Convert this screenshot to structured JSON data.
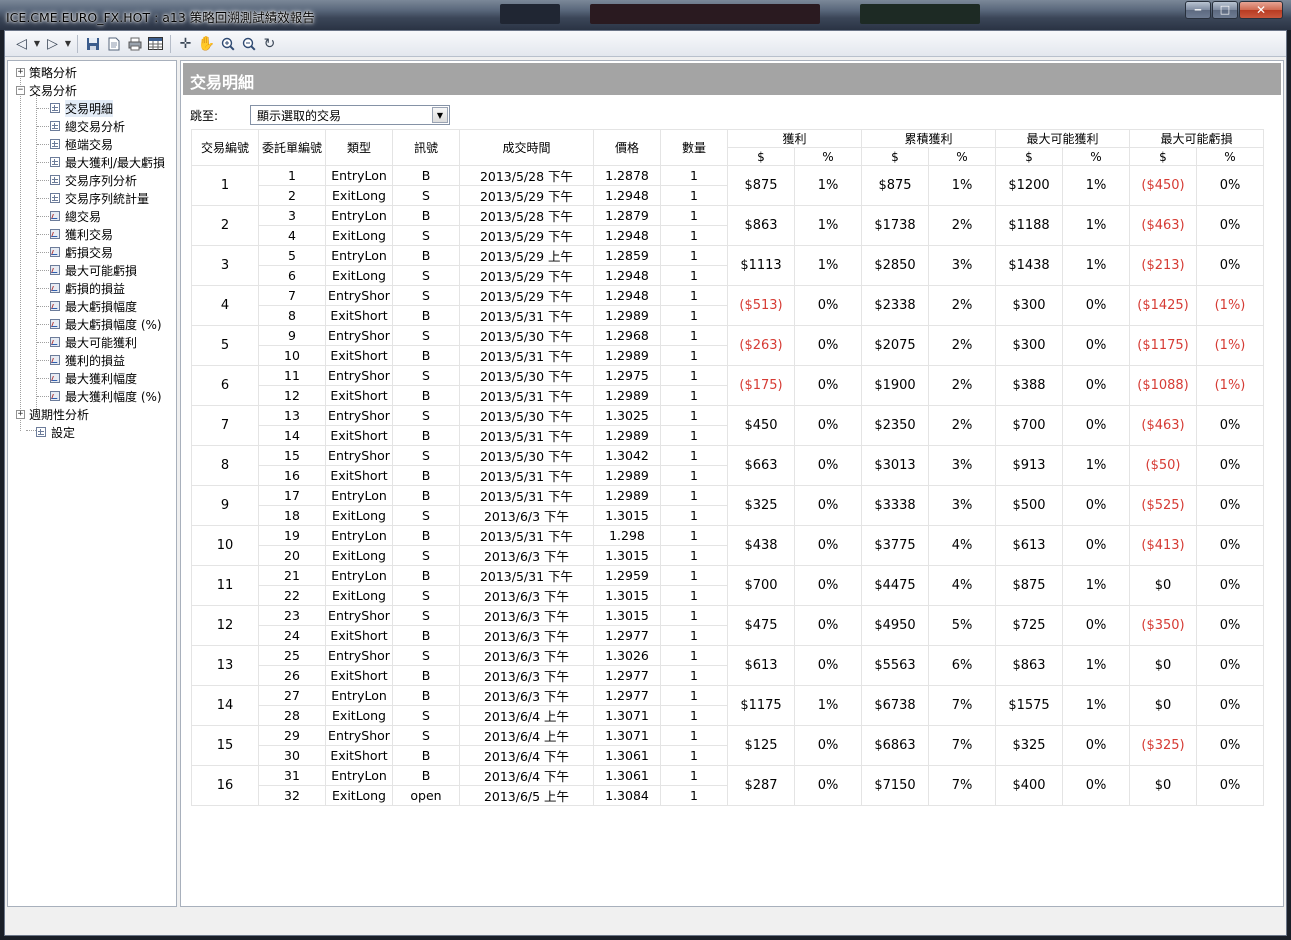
{
  "window": {
    "title": "ICE.CME.EURO_FX.HOT : a13 策略回溯測試績效報告",
    "minimize": "‒",
    "maximize": "□",
    "close": "✕"
  },
  "toolbar": {
    "icons": [
      "back-icon",
      "dropdown-arrow-icon",
      "forward-icon",
      "dropdown-arrow-icon",
      "save-icon",
      "page-icon",
      "print-icon",
      "table-icon",
      "crosshair-icon",
      "hand-icon",
      "zoom-in-icon",
      "zoom-out-icon",
      "rotate-icon"
    ]
  },
  "tree": {
    "strategy": "策略分析",
    "trade": "交易分析",
    "children": [
      "交易明細",
      "總交易分析",
      "極端交易",
      "最大獲利/最大虧損",
      "交易序列分析",
      "交易序列統計量",
      "總交易",
      "獲利交易",
      "虧損交易",
      "最大可能虧損",
      "虧損的損益",
      "最大虧損幅度",
      "最大虧損幅度 (%)",
      "最大可能獲利",
      "獲利的損益",
      "最大獲利幅度",
      "最大獲利幅度 (%)"
    ],
    "periodic": "週期性分析",
    "settings": "設定",
    "selected": "交易明細",
    "expand": "+",
    "collapse": "−"
  },
  "panel": {
    "title": "交易明細",
    "jump_label": "跳至:",
    "jump_value": "顯示選取的交易",
    "dropdown_arrow": "▼"
  },
  "table": {
    "headers": {
      "trade_no": "交易編號",
      "order_no": "委託單編號",
      "type": "類型",
      "signal": "訊號",
      "time": "成交時間",
      "price": "價格",
      "qty": "數量",
      "profit": "獲利",
      "cum_profit": "累積獲利",
      "max_profit": "最大可能獲利",
      "max_loss": "最大可能虧損",
      "dollar": "$",
      "pct": "%"
    },
    "trades": [
      {
        "no": "1",
        "legs": [
          {
            "order": "1",
            "type": "EntryLon",
            "signal": "B",
            "time": "2013/5/28 下午",
            "price": "1.2878",
            "qty": "1"
          },
          {
            "order": "2",
            "type": "ExitLong",
            "signal": "S",
            "time": "2013/5/29 下午",
            "price": "1.2948",
            "qty": "1"
          }
        ],
        "profit": "$875",
        "profit_pct": "1%",
        "cum": "$875",
        "cum_pct": "1%",
        "mfe": "$1200",
        "mfe_pct": "1%",
        "mae": "($450)",
        "mae_pct": "0%"
      },
      {
        "no": "2",
        "legs": [
          {
            "order": "3",
            "type": "EntryLon",
            "signal": "B",
            "time": "2013/5/28 下午",
            "price": "1.2879",
            "qty": "1"
          },
          {
            "order": "4",
            "type": "ExitLong",
            "signal": "S",
            "time": "2013/5/29 下午",
            "price": "1.2948",
            "qty": "1"
          }
        ],
        "profit": "$863",
        "profit_pct": "1%",
        "cum": "$1738",
        "cum_pct": "2%",
        "mfe": "$1188",
        "mfe_pct": "1%",
        "mae": "($463)",
        "mae_pct": "0%"
      },
      {
        "no": "3",
        "legs": [
          {
            "order": "5",
            "type": "EntryLon",
            "signal": "B",
            "time": "2013/5/29 上午",
            "price": "1.2859",
            "qty": "1"
          },
          {
            "order": "6",
            "type": "ExitLong",
            "signal": "S",
            "time": "2013/5/29 下午",
            "price": "1.2948",
            "qty": "1"
          }
        ],
        "profit": "$1113",
        "profit_pct": "1%",
        "cum": "$2850",
        "cum_pct": "3%",
        "mfe": "$1438",
        "mfe_pct": "1%",
        "mae": "($213)",
        "mae_pct": "0%"
      },
      {
        "no": "4",
        "legs": [
          {
            "order": "7",
            "type": "EntryShor",
            "signal": "S",
            "time": "2013/5/29 下午",
            "price": "1.2948",
            "qty": "1"
          },
          {
            "order": "8",
            "type": "ExitShort",
            "signal": "B",
            "time": "2013/5/31 下午",
            "price": "1.2989",
            "qty": "1"
          }
        ],
        "profit": "($513)",
        "profit_pct": "0%",
        "cum": "$2338",
        "cum_pct": "2%",
        "mfe": "$300",
        "mfe_pct": "0%",
        "mae": "($1425)",
        "mae_pct": "(1%)"
      },
      {
        "no": "5",
        "legs": [
          {
            "order": "9",
            "type": "EntryShor",
            "signal": "S",
            "time": "2013/5/30 下午",
            "price": "1.2968",
            "qty": "1"
          },
          {
            "order": "10",
            "type": "ExitShort",
            "signal": "B",
            "time": "2013/5/31 下午",
            "price": "1.2989",
            "qty": "1"
          }
        ],
        "profit": "($263)",
        "profit_pct": "0%",
        "cum": "$2075",
        "cum_pct": "2%",
        "mfe": "$300",
        "mfe_pct": "0%",
        "mae": "($1175)",
        "mae_pct": "(1%)"
      },
      {
        "no": "6",
        "legs": [
          {
            "order": "11",
            "type": "EntryShor",
            "signal": "S",
            "time": "2013/5/30 下午",
            "price": "1.2975",
            "qty": "1"
          },
          {
            "order": "12",
            "type": "ExitShort",
            "signal": "B",
            "time": "2013/5/31 下午",
            "price": "1.2989",
            "qty": "1"
          }
        ],
        "profit": "($175)",
        "profit_pct": "0%",
        "cum": "$1900",
        "cum_pct": "2%",
        "mfe": "$388",
        "mfe_pct": "0%",
        "mae": "($1088)",
        "mae_pct": "(1%)"
      },
      {
        "no": "7",
        "legs": [
          {
            "order": "13",
            "type": "EntryShor",
            "signal": "S",
            "time": "2013/5/30 下午",
            "price": "1.3025",
            "qty": "1"
          },
          {
            "order": "14",
            "type": "ExitShort",
            "signal": "B",
            "time": "2013/5/31 下午",
            "price": "1.2989",
            "qty": "1"
          }
        ],
        "profit": "$450",
        "profit_pct": "0%",
        "cum": "$2350",
        "cum_pct": "2%",
        "mfe": "$700",
        "mfe_pct": "0%",
        "mae": "($463)",
        "mae_pct": "0%"
      },
      {
        "no": "8",
        "legs": [
          {
            "order": "15",
            "type": "EntryShor",
            "signal": "S",
            "time": "2013/5/30 下午",
            "price": "1.3042",
            "qty": "1"
          },
          {
            "order": "16",
            "type": "ExitShort",
            "signal": "B",
            "time": "2013/5/31 下午",
            "price": "1.2989",
            "qty": "1"
          }
        ],
        "profit": "$663",
        "profit_pct": "0%",
        "cum": "$3013",
        "cum_pct": "3%",
        "mfe": "$913",
        "mfe_pct": "1%",
        "mae": "($50)",
        "mae_pct": "0%"
      },
      {
        "no": "9",
        "legs": [
          {
            "order": "17",
            "type": "EntryLon",
            "signal": "B",
            "time": "2013/5/31 下午",
            "price": "1.2989",
            "qty": "1"
          },
          {
            "order": "18",
            "type": "ExitLong",
            "signal": "S",
            "time": "2013/6/3 下午",
            "price": "1.3015",
            "qty": "1"
          }
        ],
        "profit": "$325",
        "profit_pct": "0%",
        "cum": "$3338",
        "cum_pct": "3%",
        "mfe": "$500",
        "mfe_pct": "0%",
        "mae": "($525)",
        "mae_pct": "0%"
      },
      {
        "no": "10",
        "legs": [
          {
            "order": "19",
            "type": "EntryLon",
            "signal": "B",
            "time": "2013/5/31 下午",
            "price": "1.298",
            "qty": "1"
          },
          {
            "order": "20",
            "type": "ExitLong",
            "signal": "S",
            "time": "2013/6/3 下午",
            "price": "1.3015",
            "qty": "1"
          }
        ],
        "profit": "$438",
        "profit_pct": "0%",
        "cum": "$3775",
        "cum_pct": "4%",
        "mfe": "$613",
        "mfe_pct": "0%",
        "mae": "($413)",
        "mae_pct": "0%"
      },
      {
        "no": "11",
        "legs": [
          {
            "order": "21",
            "type": "EntryLon",
            "signal": "B",
            "time": "2013/5/31 下午",
            "price": "1.2959",
            "qty": "1"
          },
          {
            "order": "22",
            "type": "ExitLong",
            "signal": "S",
            "time": "2013/6/3 下午",
            "price": "1.3015",
            "qty": "1"
          }
        ],
        "profit": "$700",
        "profit_pct": "0%",
        "cum": "$4475",
        "cum_pct": "4%",
        "mfe": "$875",
        "mfe_pct": "1%",
        "mae": "$0",
        "mae_pct": "0%"
      },
      {
        "no": "12",
        "legs": [
          {
            "order": "23",
            "type": "EntryShor",
            "signal": "S",
            "time": "2013/6/3 下午",
            "price": "1.3015",
            "qty": "1"
          },
          {
            "order": "24",
            "type": "ExitShort",
            "signal": "B",
            "time": "2013/6/3 下午",
            "price": "1.2977",
            "qty": "1"
          }
        ],
        "profit": "$475",
        "profit_pct": "0%",
        "cum": "$4950",
        "cum_pct": "5%",
        "mfe": "$725",
        "mfe_pct": "0%",
        "mae": "($350)",
        "mae_pct": "0%"
      },
      {
        "no": "13",
        "legs": [
          {
            "order": "25",
            "type": "EntryShor",
            "signal": "S",
            "time": "2013/6/3 下午",
            "price": "1.3026",
            "qty": "1"
          },
          {
            "order": "26",
            "type": "ExitShort",
            "signal": "B",
            "time": "2013/6/3 下午",
            "price": "1.2977",
            "qty": "1"
          }
        ],
        "profit": "$613",
        "profit_pct": "0%",
        "cum": "$5563",
        "cum_pct": "6%",
        "mfe": "$863",
        "mfe_pct": "1%",
        "mae": "$0",
        "mae_pct": "0%"
      },
      {
        "no": "14",
        "legs": [
          {
            "order": "27",
            "type": "EntryLon",
            "signal": "B",
            "time": "2013/6/3 下午",
            "price": "1.2977",
            "qty": "1"
          },
          {
            "order": "28",
            "type": "ExitLong",
            "signal": "S",
            "time": "2013/6/4 上午",
            "price": "1.3071",
            "qty": "1"
          }
        ],
        "profit": "$1175",
        "profit_pct": "1%",
        "cum": "$6738",
        "cum_pct": "7%",
        "mfe": "$1575",
        "mfe_pct": "1%",
        "mae": "$0",
        "mae_pct": "0%"
      },
      {
        "no": "15",
        "legs": [
          {
            "order": "29",
            "type": "EntryShor",
            "signal": "S",
            "time": "2013/6/4 上午",
            "price": "1.3071",
            "qty": "1"
          },
          {
            "order": "30",
            "type": "ExitShort",
            "signal": "B",
            "time": "2013/6/4 下午",
            "price": "1.3061",
            "qty": "1"
          }
        ],
        "profit": "$125",
        "profit_pct": "0%",
        "cum": "$6863",
        "cum_pct": "7%",
        "mfe": "$325",
        "mfe_pct": "0%",
        "mae": "($325)",
        "mae_pct": "0%"
      },
      {
        "no": "16",
        "legs": [
          {
            "order": "31",
            "type": "EntryLon",
            "signal": "B",
            "time": "2013/6/4 下午",
            "price": "1.3061",
            "qty": "1"
          },
          {
            "order": "32",
            "type": "ExitLong",
            "signal": "open",
            "time": "2013/6/5 上午",
            "price": "1.3084",
            "qty": "1"
          }
        ],
        "profit": "$287",
        "profit_pct": "0%",
        "cum": "$7150",
        "cum_pct": "7%",
        "mfe": "$400",
        "mfe_pct": "0%",
        "mae": "$0",
        "mae_pct": "0%"
      }
    ]
  },
  "colors": {
    "negative": "#d63b34",
    "header_bar": "#a4a4a4"
  }
}
